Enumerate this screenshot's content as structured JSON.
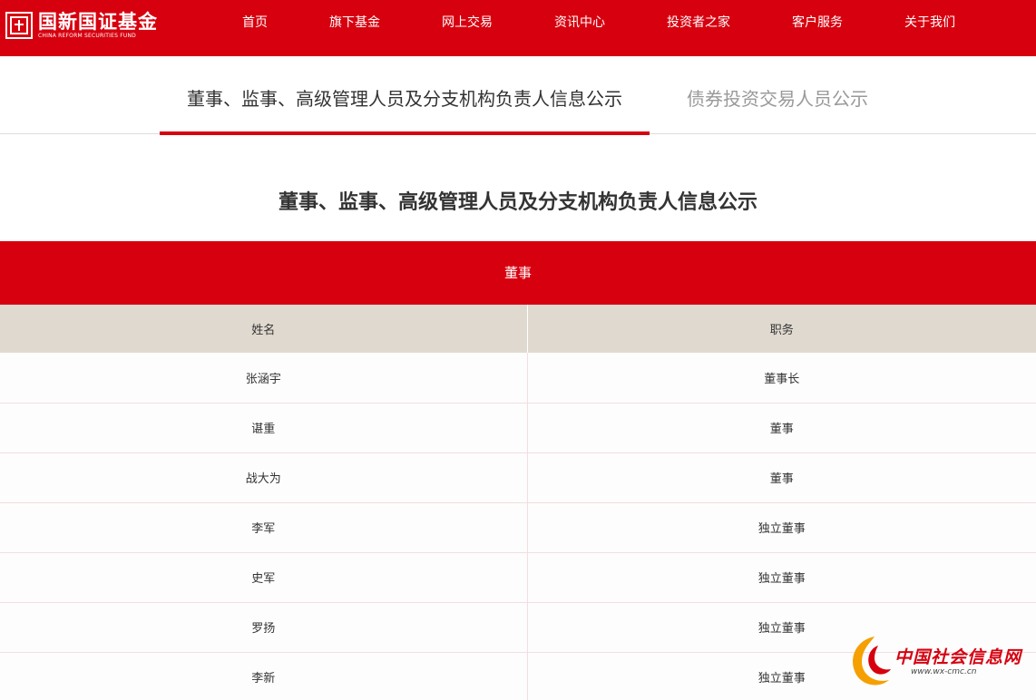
{
  "header": {
    "logo_cn": "国新国证基金",
    "logo_en": "CHINA REFORM SECURITIES FUND",
    "nav": [
      "首页",
      "旗下基金",
      "网上交易",
      "资讯中心",
      "投资者之家",
      "客户服务",
      "关于我们"
    ]
  },
  "tabs": [
    {
      "label": "董事、监事、高级管理人员及分支机构负责人信息公示",
      "active": true
    },
    {
      "label": "债券投资交易人员公示",
      "active": false
    }
  ],
  "page_title": "董事、监事、高级管理人员及分支机构负责人信息公示",
  "section": {
    "title": "董事",
    "columns": [
      "姓名",
      "职务"
    ],
    "rows": [
      [
        "张涵宇",
        "董事长"
      ],
      [
        "谌重",
        "董事"
      ],
      [
        "战大为",
        "董事"
      ],
      [
        "李军",
        "独立董事"
      ],
      [
        "史军",
        "独立董事"
      ],
      [
        "罗扬",
        "独立董事"
      ],
      [
        "李新",
        "独立董事"
      ]
    ]
  },
  "watermark": {
    "cn": "中国社会信息网",
    "en": "www.wx-cmc.cn"
  },
  "colors": {
    "brand_red": "#d7000f",
    "table_header_bg": "#e0d9cf",
    "watermark_orange": "#f5a000"
  }
}
